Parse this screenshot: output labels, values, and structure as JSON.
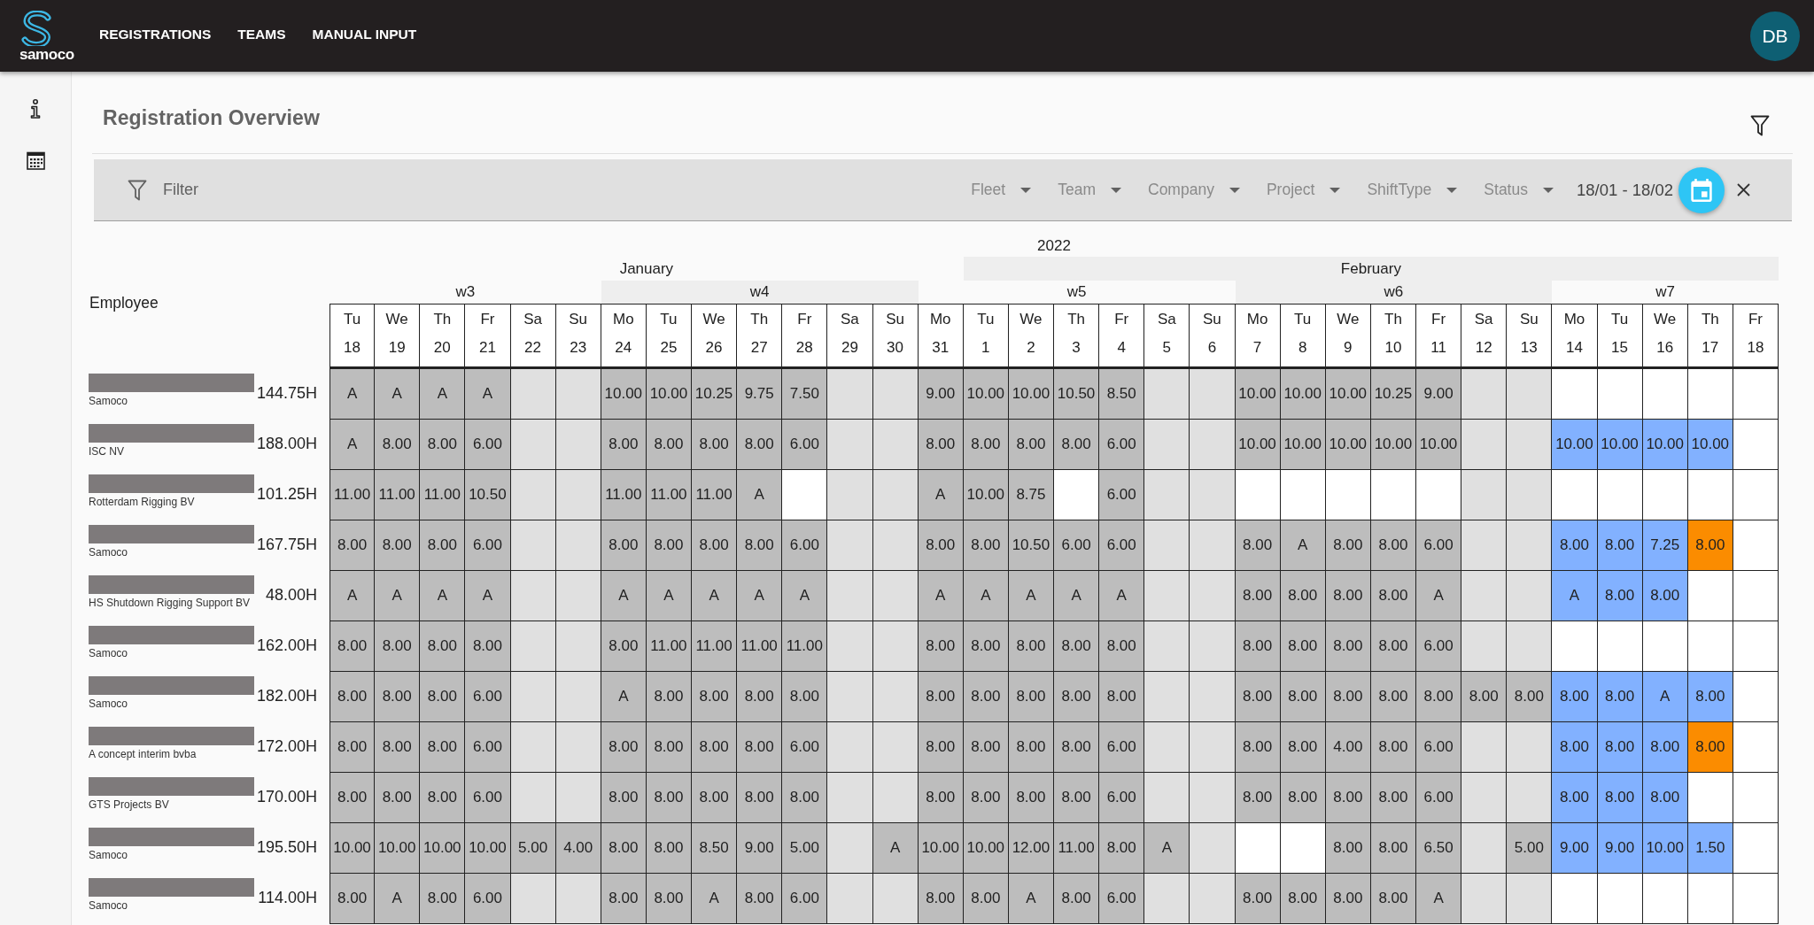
{
  "topbar": {
    "logo_text": "samoco",
    "nav_items": [
      {
        "label": "REGISTRATIONS",
        "selected": false
      },
      {
        "label": "TEAMS",
        "selected": false
      },
      {
        "label": "MANUAL INPUT",
        "selected": false
      }
    ],
    "avatar": {
      "initials": "DB"
    }
  },
  "page": {
    "title": "Registration Overview"
  },
  "filter_bar": {
    "label": "Filter",
    "dropdowns": [
      {
        "placeholder": "Fleet"
      },
      {
        "placeholder": "Team"
      },
      {
        "placeholder": "Company"
      },
      {
        "placeholder": "Project"
      },
      {
        "placeholder": "ShiftType"
      },
      {
        "placeholder": "Status"
      }
    ],
    "date_range": {
      "value": "18/01 - 18/02"
    }
  },
  "registrations": {
    "employee_header": "Employee",
    "year": "2022",
    "months": [
      {
        "label": "January",
        "shaded": false,
        "weeks": [
          {
            "label": "w3",
            "shaded": false,
            "days": [
              {
                "weekday": "Tu",
                "date": "18"
              },
              {
                "weekday": "We",
                "date": "19"
              },
              {
                "weekday": "Th",
                "date": "20"
              },
              {
                "weekday": "Fr",
                "date": "21"
              },
              {
                "weekday": "Sa",
                "date": "22"
              },
              {
                "weekday": "Su",
                "date": "23"
              }
            ]
          },
          {
            "label": "w4",
            "shaded": true,
            "days": [
              {
                "weekday": "Mo",
                "date": "24"
              },
              {
                "weekday": "Tu",
                "date": "25"
              },
              {
                "weekday": "We",
                "date": "26"
              },
              {
                "weekday": "Th",
                "date": "27"
              },
              {
                "weekday": "Fr",
                "date": "28"
              },
              {
                "weekday": "Sa",
                "date": "29"
              },
              {
                "weekday": "Su",
                "date": "30"
              }
            ]
          },
          {
            "label": "w5",
            "shaded": false,
            "days": [
              {
                "weekday": "Mo",
                "date": "31"
              }
            ]
          }
        ]
      },
      {
        "label": "February",
        "shaded": true,
        "weeks": [
          {
            "days": [
              {
                "weekday": "Tu",
                "date": "1"
              },
              {
                "weekday": "We",
                "date": "2"
              },
              {
                "weekday": "Th",
                "date": "3"
              },
              {
                "weekday": "Fr",
                "date": "4"
              },
              {
                "weekday": "Sa",
                "date": "5"
              },
              {
                "weekday": "Su",
                "date": "6"
              }
            ]
          },
          {
            "label": "w6",
            "shaded": true,
            "days": [
              {
                "weekday": "Mo",
                "date": "7"
              },
              {
                "weekday": "Tu",
                "date": "8"
              },
              {
                "weekday": "We",
                "date": "9"
              },
              {
                "weekday": "Th",
                "date": "10"
              },
              {
                "weekday": "Fr",
                "date": "11"
              },
              {
                "weekday": "Sa",
                "date": "12"
              },
              {
                "weekday": "Su",
                "date": "13"
              }
            ]
          },
          {
            "label": "w7",
            "shaded": false,
            "days": [
              {
                "weekday": "Mo",
                "date": "14"
              },
              {
                "weekday": "Tu",
                "date": "15"
              },
              {
                "weekday": "We",
                "date": "16"
              },
              {
                "weekday": "Th",
                "date": "17"
              },
              {
                "weekday": "Fr",
                "date": "18"
              }
            ]
          }
        ]
      }
    ],
    "rows": [
      {
        "company": "Samoco",
        "total": "144.75H",
        "cells": [
          {
            "text": "A",
            "color": "#bdbdbd"
          },
          {
            "text": "A",
            "color": "#bdbdbd"
          },
          {
            "text": "A",
            "color": "#bdbdbd"
          },
          {
            "text": "A",
            "color": "#bdbdbd"
          },
          {
            "color": "#e0e0e0"
          },
          {
            "color": "#e0e0e0"
          },
          {
            "text": "10.00",
            "color": "#bdbdbd"
          },
          {
            "text": "10.00",
            "color": "#bdbdbd"
          },
          {
            "text": "10.25",
            "color": "#bdbdbd"
          },
          {
            "text": "9.75",
            "color": "#bdbdbd"
          },
          {
            "text": "7.50",
            "color": "#bdbdbd"
          },
          {
            "color": "#e0e0e0"
          },
          {
            "color": "#e0e0e0"
          },
          {
            "text": "9.00",
            "color": "#bdbdbd"
          },
          {
            "text": "10.00",
            "color": "#bdbdbd"
          },
          {
            "text": "10.00",
            "color": "#bdbdbd"
          },
          {
            "text": "10.50",
            "color": "#bdbdbd"
          },
          {
            "text": "8.50",
            "color": "#bdbdbd"
          },
          {
            "color": "#e0e0e0"
          },
          {
            "color": "#e0e0e0"
          },
          {
            "text": "10.00",
            "color": "#bdbdbd"
          },
          {
            "text": "10.00",
            "color": "#bdbdbd"
          },
          {
            "text": "10.00",
            "color": "#bdbdbd"
          },
          {
            "text": "10.25",
            "color": "#bdbdbd"
          },
          {
            "text": "9.00",
            "color": "#bdbdbd"
          },
          {
            "color": "#e0e0e0"
          },
          {
            "color": "#e0e0e0"
          },
          {
            "color": "#ffffff"
          },
          {
            "color": "#ffffff"
          },
          {
            "color": "#ffffff"
          },
          {
            "color": "#ffffff"
          },
          {
            "color": "#ffffff"
          }
        ]
      },
      {
        "company": "ISC NV",
        "total": "188.00H",
        "cells": [
          {
            "text": "A",
            "color": "#bdbdbd"
          },
          {
            "text": "8.00",
            "color": "#bdbdbd"
          },
          {
            "text": "8.00",
            "color": "#bdbdbd"
          },
          {
            "text": "6.00",
            "color": "#bdbdbd"
          },
          {
            "color": "#e0e0e0"
          },
          {
            "color": "#e0e0e0"
          },
          {
            "text": "8.00",
            "color": "#bdbdbd"
          },
          {
            "text": "8.00",
            "color": "#bdbdbd"
          },
          {
            "text": "8.00",
            "color": "#bdbdbd"
          },
          {
            "text": "8.00",
            "color": "#bdbdbd"
          },
          {
            "text": "6.00",
            "color": "#bdbdbd"
          },
          {
            "color": "#e0e0e0"
          },
          {
            "color": "#e0e0e0"
          },
          {
            "text": "8.00",
            "color": "#bdbdbd"
          },
          {
            "text": "8.00",
            "color": "#bdbdbd"
          },
          {
            "text": "8.00",
            "color": "#bdbdbd"
          },
          {
            "text": "8.00",
            "color": "#bdbdbd"
          },
          {
            "text": "6.00",
            "color": "#bdbdbd"
          },
          {
            "color": "#e0e0e0"
          },
          {
            "color": "#e0e0e0"
          },
          {
            "text": "10.00",
            "color": "#bdbdbd"
          },
          {
            "text": "10.00",
            "color": "#bdbdbd"
          },
          {
            "text": "10.00",
            "color": "#bdbdbd"
          },
          {
            "text": "10.00",
            "color": "#bdbdbd"
          },
          {
            "text": "10.00",
            "color": "#bdbdbd"
          },
          {
            "color": "#e0e0e0"
          },
          {
            "color": "#e0e0e0"
          },
          {
            "text": "10.00",
            "color": "#82b1ff"
          },
          {
            "text": "10.00",
            "color": "#82b1ff"
          },
          {
            "text": "10.00",
            "color": "#82b1ff"
          },
          {
            "text": "10.00",
            "color": "#82b1ff"
          },
          {
            "color": "#ffffff"
          }
        ]
      },
      {
        "company": "Rotterdam Rigging BV",
        "total": "101.25H",
        "cells": [
          {
            "text": "11.00",
            "color": "#bdbdbd"
          },
          {
            "text": "11.00",
            "color": "#bdbdbd"
          },
          {
            "text": "11.00",
            "color": "#bdbdbd"
          },
          {
            "text": "10.50",
            "color": "#bdbdbd"
          },
          {
            "color": "#e0e0e0"
          },
          {
            "color": "#e0e0e0"
          },
          {
            "text": "11.00",
            "color": "#bdbdbd"
          },
          {
            "text": "11.00",
            "color": "#bdbdbd"
          },
          {
            "text": "11.00",
            "color": "#bdbdbd"
          },
          {
            "text": "A",
            "color": "#bdbdbd"
          },
          {
            "color": "#ffffff"
          },
          {
            "color": "#e0e0e0"
          },
          {
            "color": "#e0e0e0"
          },
          {
            "text": "A",
            "color": "#bdbdbd"
          },
          {
            "text": "10.00",
            "color": "#bdbdbd"
          },
          {
            "text": "8.75",
            "color": "#bdbdbd"
          },
          {
            "color": "#ffffff"
          },
          {
            "text": "6.00",
            "color": "#bdbdbd"
          },
          {
            "color": "#e0e0e0"
          },
          {
            "color": "#e0e0e0"
          },
          {
            "color": "#ffffff"
          },
          {
            "color": "#ffffff"
          },
          {
            "color": "#ffffff"
          },
          {
            "color": "#ffffff"
          },
          {
            "color": "#ffffff"
          },
          {
            "color": "#e0e0e0"
          },
          {
            "color": "#e0e0e0"
          },
          {
            "color": "#ffffff"
          },
          {
            "color": "#ffffff"
          },
          {
            "color": "#ffffff"
          },
          {
            "color": "#ffffff"
          },
          {
            "color": "#ffffff"
          }
        ]
      },
      {
        "company": "Samoco",
        "total": "167.75H",
        "cells": [
          {
            "text": "8.00",
            "color": "#bdbdbd"
          },
          {
            "text": "8.00",
            "color": "#bdbdbd"
          },
          {
            "text": "8.00",
            "color": "#bdbdbd"
          },
          {
            "text": "6.00",
            "color": "#bdbdbd"
          },
          {
            "color": "#e0e0e0"
          },
          {
            "color": "#e0e0e0"
          },
          {
            "text": "8.00",
            "color": "#bdbdbd"
          },
          {
            "text": "8.00",
            "color": "#bdbdbd"
          },
          {
            "text": "8.00",
            "color": "#bdbdbd"
          },
          {
            "text": "8.00",
            "color": "#bdbdbd"
          },
          {
            "text": "6.00",
            "color": "#bdbdbd"
          },
          {
            "color": "#e0e0e0"
          },
          {
            "color": "#e0e0e0"
          },
          {
            "text": "8.00",
            "color": "#bdbdbd"
          },
          {
            "text": "8.00",
            "color": "#bdbdbd"
          },
          {
            "text": "10.50",
            "color": "#bdbdbd"
          },
          {
            "text": "6.00",
            "color": "#bdbdbd"
          },
          {
            "text": "6.00",
            "color": "#bdbdbd"
          },
          {
            "color": "#e0e0e0"
          },
          {
            "color": "#e0e0e0"
          },
          {
            "text": "8.00",
            "color": "#bdbdbd"
          },
          {
            "text": "A",
            "color": "#bdbdbd"
          },
          {
            "text": "8.00",
            "color": "#bdbdbd"
          },
          {
            "text": "8.00",
            "color": "#bdbdbd"
          },
          {
            "text": "6.00",
            "color": "#bdbdbd"
          },
          {
            "color": "#e0e0e0"
          },
          {
            "color": "#e0e0e0"
          },
          {
            "text": "8.00",
            "color": "#82b1ff"
          },
          {
            "text": "8.00",
            "color": "#82b1ff"
          },
          {
            "text": "7.25",
            "color": "#82b1ff"
          },
          {
            "text": "8.00",
            "color": "#fb8c00"
          },
          {
            "color": "#ffffff"
          }
        ]
      },
      {
        "company": "HS Shutdown Rigging Support BV",
        "total": "48.00H",
        "cells": [
          {
            "text": "A",
            "color": "#bdbdbd"
          },
          {
            "text": "A",
            "color": "#bdbdbd"
          },
          {
            "text": "A",
            "color": "#bdbdbd"
          },
          {
            "text": "A",
            "color": "#bdbdbd"
          },
          {
            "color": "#e0e0e0"
          },
          {
            "color": "#e0e0e0"
          },
          {
            "text": "A",
            "color": "#bdbdbd"
          },
          {
            "text": "A",
            "color": "#bdbdbd"
          },
          {
            "text": "A",
            "color": "#bdbdbd"
          },
          {
            "text": "A",
            "color": "#bdbdbd"
          },
          {
            "text": "A",
            "color": "#bdbdbd"
          },
          {
            "color": "#e0e0e0"
          },
          {
            "color": "#e0e0e0"
          },
          {
            "text": "A",
            "color": "#bdbdbd"
          },
          {
            "text": "A",
            "color": "#bdbdbd"
          },
          {
            "text": "A",
            "color": "#bdbdbd"
          },
          {
            "text": "A",
            "color": "#bdbdbd"
          },
          {
            "text": "A",
            "color": "#bdbdbd"
          },
          {
            "color": "#e0e0e0"
          },
          {
            "color": "#e0e0e0"
          },
          {
            "text": "8.00",
            "color": "#bdbdbd"
          },
          {
            "text": "8.00",
            "color": "#bdbdbd"
          },
          {
            "text": "8.00",
            "color": "#bdbdbd"
          },
          {
            "text": "8.00",
            "color": "#bdbdbd"
          },
          {
            "text": "A",
            "color": "#bdbdbd"
          },
          {
            "color": "#e0e0e0"
          },
          {
            "color": "#e0e0e0"
          },
          {
            "text": "A",
            "color": "#82b1ff"
          },
          {
            "text": "8.00",
            "color": "#82b1ff"
          },
          {
            "text": "8.00",
            "color": "#82b1ff"
          },
          {
            "color": "#ffffff"
          },
          {
            "color": "#ffffff"
          }
        ]
      },
      {
        "company": "Samoco",
        "total": "162.00H",
        "cells": [
          {
            "text": "8.00",
            "color": "#bdbdbd"
          },
          {
            "text": "8.00",
            "color": "#bdbdbd"
          },
          {
            "text": "8.00",
            "color": "#bdbdbd"
          },
          {
            "text": "8.00",
            "color": "#bdbdbd"
          },
          {
            "color": "#e0e0e0"
          },
          {
            "color": "#e0e0e0"
          },
          {
            "text": "8.00",
            "color": "#bdbdbd"
          },
          {
            "text": "11.00",
            "color": "#bdbdbd"
          },
          {
            "text": "11.00",
            "color": "#bdbdbd"
          },
          {
            "text": "11.00",
            "color": "#bdbdbd"
          },
          {
            "text": "11.00",
            "color": "#bdbdbd"
          },
          {
            "color": "#e0e0e0"
          },
          {
            "color": "#e0e0e0"
          },
          {
            "text": "8.00",
            "color": "#bdbdbd"
          },
          {
            "text": "8.00",
            "color": "#bdbdbd"
          },
          {
            "text": "8.00",
            "color": "#bdbdbd"
          },
          {
            "text": "8.00",
            "color": "#bdbdbd"
          },
          {
            "text": "8.00",
            "color": "#bdbdbd"
          },
          {
            "color": "#e0e0e0"
          },
          {
            "color": "#e0e0e0"
          },
          {
            "text": "8.00",
            "color": "#bdbdbd"
          },
          {
            "text": "8.00",
            "color": "#bdbdbd"
          },
          {
            "text": "8.00",
            "color": "#bdbdbd"
          },
          {
            "text": "8.00",
            "color": "#bdbdbd"
          },
          {
            "text": "6.00",
            "color": "#bdbdbd"
          },
          {
            "color": "#e0e0e0"
          },
          {
            "color": "#e0e0e0"
          },
          {
            "color": "#ffffff"
          },
          {
            "color": "#ffffff"
          },
          {
            "color": "#ffffff"
          },
          {
            "color": "#ffffff"
          },
          {
            "color": "#ffffff"
          }
        ]
      },
      {
        "company": "Samoco",
        "total": "182.00H",
        "cells": [
          {
            "text": "8.00",
            "color": "#bdbdbd"
          },
          {
            "text": "8.00",
            "color": "#bdbdbd"
          },
          {
            "text": "8.00",
            "color": "#bdbdbd"
          },
          {
            "text": "6.00",
            "color": "#bdbdbd"
          },
          {
            "color": "#e0e0e0"
          },
          {
            "color": "#e0e0e0"
          },
          {
            "text": "A",
            "color": "#bdbdbd"
          },
          {
            "text": "8.00",
            "color": "#bdbdbd"
          },
          {
            "text": "8.00",
            "color": "#bdbdbd"
          },
          {
            "text": "8.00",
            "color": "#bdbdbd"
          },
          {
            "text": "8.00",
            "color": "#bdbdbd"
          },
          {
            "color": "#e0e0e0"
          },
          {
            "color": "#e0e0e0"
          },
          {
            "text": "8.00",
            "color": "#bdbdbd"
          },
          {
            "text": "8.00",
            "color": "#bdbdbd"
          },
          {
            "text": "8.00",
            "color": "#bdbdbd"
          },
          {
            "text": "8.00",
            "color": "#bdbdbd"
          },
          {
            "text": "8.00",
            "color": "#bdbdbd"
          },
          {
            "color": "#e0e0e0"
          },
          {
            "color": "#e0e0e0"
          },
          {
            "text": "8.00",
            "color": "#bdbdbd"
          },
          {
            "text": "8.00",
            "color": "#bdbdbd"
          },
          {
            "text": "8.00",
            "color": "#bdbdbd"
          },
          {
            "text": "8.00",
            "color": "#bdbdbd"
          },
          {
            "text": "8.00",
            "color": "#bdbdbd"
          },
          {
            "text": "8.00",
            "color": "#bdbdbd"
          },
          {
            "text": "8.00",
            "color": "#bdbdbd"
          },
          {
            "text": "8.00",
            "color": "#82b1ff"
          },
          {
            "text": "8.00",
            "color": "#82b1ff"
          },
          {
            "text": "A",
            "color": "#82b1ff"
          },
          {
            "text": "8.00",
            "color": "#82b1ff"
          },
          {
            "color": "#ffffff"
          }
        ]
      },
      {
        "company": "A concept interim bvba",
        "total": "172.00H",
        "cells": [
          {
            "text": "8.00",
            "color": "#bdbdbd"
          },
          {
            "text": "8.00",
            "color": "#bdbdbd"
          },
          {
            "text": "8.00",
            "color": "#bdbdbd"
          },
          {
            "text": "6.00",
            "color": "#bdbdbd"
          },
          {
            "color": "#e0e0e0"
          },
          {
            "color": "#e0e0e0"
          },
          {
            "text": "8.00",
            "color": "#bdbdbd"
          },
          {
            "text": "8.00",
            "color": "#bdbdbd"
          },
          {
            "text": "8.00",
            "color": "#bdbdbd"
          },
          {
            "text": "8.00",
            "color": "#bdbdbd"
          },
          {
            "text": "6.00",
            "color": "#bdbdbd"
          },
          {
            "color": "#e0e0e0"
          },
          {
            "color": "#e0e0e0"
          },
          {
            "text": "8.00",
            "color": "#bdbdbd"
          },
          {
            "text": "8.00",
            "color": "#bdbdbd"
          },
          {
            "text": "8.00",
            "color": "#bdbdbd"
          },
          {
            "text": "8.00",
            "color": "#bdbdbd"
          },
          {
            "text": "6.00",
            "color": "#bdbdbd"
          },
          {
            "color": "#e0e0e0"
          },
          {
            "color": "#e0e0e0"
          },
          {
            "text": "8.00",
            "color": "#bdbdbd"
          },
          {
            "text": "8.00",
            "color": "#bdbdbd"
          },
          {
            "text": "4.00",
            "color": "#bdbdbd"
          },
          {
            "text": "8.00",
            "color": "#bdbdbd"
          },
          {
            "text": "6.00",
            "color": "#bdbdbd"
          },
          {
            "color": "#e0e0e0"
          },
          {
            "color": "#e0e0e0"
          },
          {
            "text": "8.00",
            "color": "#82b1ff"
          },
          {
            "text": "8.00",
            "color": "#82b1ff"
          },
          {
            "text": "8.00",
            "color": "#82b1ff"
          },
          {
            "text": "8.00",
            "color": "#fb8c00"
          },
          {
            "color": "#ffffff"
          }
        ]
      },
      {
        "company": "GTS Projects BV",
        "total": "170.00H",
        "cells": [
          {
            "text": "8.00",
            "color": "#bdbdbd"
          },
          {
            "text": "8.00",
            "color": "#bdbdbd"
          },
          {
            "text": "8.00",
            "color": "#bdbdbd"
          },
          {
            "text": "6.00",
            "color": "#bdbdbd"
          },
          {
            "color": "#e0e0e0"
          },
          {
            "color": "#e0e0e0"
          },
          {
            "text": "8.00",
            "color": "#bdbdbd"
          },
          {
            "text": "8.00",
            "color": "#bdbdbd"
          },
          {
            "text": "8.00",
            "color": "#bdbdbd"
          },
          {
            "text": "8.00",
            "color": "#bdbdbd"
          },
          {
            "text": "8.00",
            "color": "#bdbdbd"
          },
          {
            "color": "#e0e0e0"
          },
          {
            "color": "#e0e0e0"
          },
          {
            "text": "8.00",
            "color": "#bdbdbd"
          },
          {
            "text": "8.00",
            "color": "#bdbdbd"
          },
          {
            "text": "8.00",
            "color": "#bdbdbd"
          },
          {
            "text": "8.00",
            "color": "#bdbdbd"
          },
          {
            "text": "6.00",
            "color": "#bdbdbd"
          },
          {
            "color": "#e0e0e0"
          },
          {
            "color": "#e0e0e0"
          },
          {
            "text": "8.00",
            "color": "#bdbdbd"
          },
          {
            "text": "8.00",
            "color": "#bdbdbd"
          },
          {
            "text": "8.00",
            "color": "#bdbdbd"
          },
          {
            "text": "8.00",
            "color": "#bdbdbd"
          },
          {
            "text": "6.00",
            "color": "#bdbdbd"
          },
          {
            "color": "#e0e0e0"
          },
          {
            "color": "#e0e0e0"
          },
          {
            "text": "8.00",
            "color": "#82b1ff"
          },
          {
            "text": "8.00",
            "color": "#82b1ff"
          },
          {
            "text": "8.00",
            "color": "#82b1ff"
          },
          {
            "color": "#ffffff"
          },
          {
            "color": "#ffffff"
          }
        ]
      },
      {
        "company": "Samoco",
        "total": "195.50H",
        "cells": [
          {
            "text": "10.00",
            "color": "#bdbdbd"
          },
          {
            "text": "10.00",
            "color": "#bdbdbd"
          },
          {
            "text": "10.00",
            "color": "#bdbdbd"
          },
          {
            "text": "10.00",
            "color": "#bdbdbd"
          },
          {
            "text": "5.00",
            "color": "#bdbdbd"
          },
          {
            "text": "4.00",
            "color": "#bdbdbd"
          },
          {
            "text": "8.00",
            "color": "#bdbdbd"
          },
          {
            "text": "8.00",
            "color": "#bdbdbd"
          },
          {
            "text": "8.50",
            "color": "#bdbdbd"
          },
          {
            "text": "9.00",
            "color": "#bdbdbd"
          },
          {
            "text": "5.00",
            "color": "#bdbdbd"
          },
          {
            "color": "#e0e0e0"
          },
          {
            "text": "A",
            "color": "#bdbdbd"
          },
          {
            "text": "10.00",
            "color": "#bdbdbd"
          },
          {
            "text": "10.00",
            "color": "#bdbdbd"
          },
          {
            "text": "12.00",
            "color": "#bdbdbd"
          },
          {
            "text": "11.00",
            "color": "#bdbdbd"
          },
          {
            "text": "8.00",
            "color": "#bdbdbd"
          },
          {
            "text": "A",
            "color": "#bdbdbd"
          },
          {
            "color": "#e0e0e0"
          },
          {
            "color": "#ffffff"
          },
          {
            "color": "#ffffff"
          },
          {
            "text": "8.00",
            "color": "#bdbdbd"
          },
          {
            "text": "8.00",
            "color": "#bdbdbd"
          },
          {
            "text": "6.50",
            "color": "#bdbdbd"
          },
          {
            "color": "#e0e0e0"
          },
          {
            "text": "5.00",
            "color": "#bdbdbd"
          },
          {
            "text": "9.00",
            "color": "#82b1ff"
          },
          {
            "text": "9.00",
            "color": "#82b1ff"
          },
          {
            "text": "10.00",
            "color": "#82b1ff"
          },
          {
            "text": "1.50",
            "color": "#82b1ff"
          },
          {
            "color": "#ffffff"
          }
        ]
      },
      {
        "company": "Samoco",
        "total": "114.00H",
        "cells": [
          {
            "text": "8.00",
            "color": "#bdbdbd"
          },
          {
            "text": "A",
            "color": "#bdbdbd"
          },
          {
            "text": "8.00",
            "color": "#bdbdbd"
          },
          {
            "text": "6.00",
            "color": "#bdbdbd"
          },
          {
            "color": "#e0e0e0"
          },
          {
            "color": "#e0e0e0"
          },
          {
            "text": "8.00",
            "color": "#bdbdbd"
          },
          {
            "text": "8.00",
            "color": "#bdbdbd"
          },
          {
            "text": "A",
            "color": "#bdbdbd"
          },
          {
            "text": "8.00",
            "color": "#bdbdbd"
          },
          {
            "text": "6.00",
            "color": "#bdbdbd"
          },
          {
            "color": "#e0e0e0"
          },
          {
            "color": "#e0e0e0"
          },
          {
            "text": "8.00",
            "color": "#bdbdbd"
          },
          {
            "text": "8.00",
            "color": "#bdbdbd"
          },
          {
            "text": "A",
            "color": "#bdbdbd"
          },
          {
            "text": "8.00",
            "color": "#bdbdbd"
          },
          {
            "text": "6.00",
            "color": "#bdbdbd"
          },
          {
            "color": "#e0e0e0"
          },
          {
            "color": "#e0e0e0"
          },
          {
            "text": "8.00",
            "color": "#bdbdbd"
          },
          {
            "text": "8.00",
            "color": "#bdbdbd"
          },
          {
            "text": "8.00",
            "color": "#bdbdbd"
          },
          {
            "text": "8.00",
            "color": "#bdbdbd"
          },
          {
            "text": "A",
            "color": "#bdbdbd"
          },
          {
            "color": "#e0e0e0"
          },
          {
            "color": "#e0e0e0"
          },
          {
            "color": "#ffffff"
          },
          {
            "color": "#ffffff"
          },
          {
            "color": "#ffffff"
          },
          {
            "color": "#ffffff"
          },
          {
            "color": "#ffffff"
          }
        ]
      }
    ]
  }
}
